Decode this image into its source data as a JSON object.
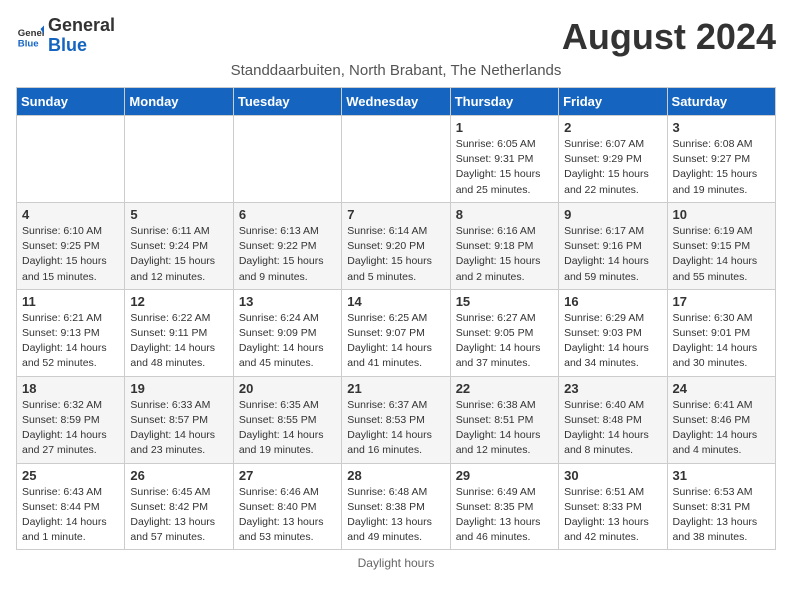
{
  "header": {
    "logo_general": "General",
    "logo_blue": "Blue",
    "month_title": "August 2024",
    "subtitle": "Standdaarbuiten, North Brabant, The Netherlands"
  },
  "days_of_week": [
    "Sunday",
    "Monday",
    "Tuesday",
    "Wednesday",
    "Thursday",
    "Friday",
    "Saturday"
  ],
  "footer": "Daylight hours",
  "weeks": [
    [
      {
        "day": "",
        "info": ""
      },
      {
        "day": "",
        "info": ""
      },
      {
        "day": "",
        "info": ""
      },
      {
        "day": "",
        "info": ""
      },
      {
        "day": "1",
        "info": "Sunrise: 6:05 AM\nSunset: 9:31 PM\nDaylight: 15 hours\nand 25 minutes."
      },
      {
        "day": "2",
        "info": "Sunrise: 6:07 AM\nSunset: 9:29 PM\nDaylight: 15 hours\nand 22 minutes."
      },
      {
        "day": "3",
        "info": "Sunrise: 6:08 AM\nSunset: 9:27 PM\nDaylight: 15 hours\nand 19 minutes."
      }
    ],
    [
      {
        "day": "4",
        "info": "Sunrise: 6:10 AM\nSunset: 9:25 PM\nDaylight: 15 hours\nand 15 minutes."
      },
      {
        "day": "5",
        "info": "Sunrise: 6:11 AM\nSunset: 9:24 PM\nDaylight: 15 hours\nand 12 minutes."
      },
      {
        "day": "6",
        "info": "Sunrise: 6:13 AM\nSunset: 9:22 PM\nDaylight: 15 hours\nand 9 minutes."
      },
      {
        "day": "7",
        "info": "Sunrise: 6:14 AM\nSunset: 9:20 PM\nDaylight: 15 hours\nand 5 minutes."
      },
      {
        "day": "8",
        "info": "Sunrise: 6:16 AM\nSunset: 9:18 PM\nDaylight: 15 hours\nand 2 minutes."
      },
      {
        "day": "9",
        "info": "Sunrise: 6:17 AM\nSunset: 9:16 PM\nDaylight: 14 hours\nand 59 minutes."
      },
      {
        "day": "10",
        "info": "Sunrise: 6:19 AM\nSunset: 9:15 PM\nDaylight: 14 hours\nand 55 minutes."
      }
    ],
    [
      {
        "day": "11",
        "info": "Sunrise: 6:21 AM\nSunset: 9:13 PM\nDaylight: 14 hours\nand 52 minutes."
      },
      {
        "day": "12",
        "info": "Sunrise: 6:22 AM\nSunset: 9:11 PM\nDaylight: 14 hours\nand 48 minutes."
      },
      {
        "day": "13",
        "info": "Sunrise: 6:24 AM\nSunset: 9:09 PM\nDaylight: 14 hours\nand 45 minutes."
      },
      {
        "day": "14",
        "info": "Sunrise: 6:25 AM\nSunset: 9:07 PM\nDaylight: 14 hours\nand 41 minutes."
      },
      {
        "day": "15",
        "info": "Sunrise: 6:27 AM\nSunset: 9:05 PM\nDaylight: 14 hours\nand 37 minutes."
      },
      {
        "day": "16",
        "info": "Sunrise: 6:29 AM\nSunset: 9:03 PM\nDaylight: 14 hours\nand 34 minutes."
      },
      {
        "day": "17",
        "info": "Sunrise: 6:30 AM\nSunset: 9:01 PM\nDaylight: 14 hours\nand 30 minutes."
      }
    ],
    [
      {
        "day": "18",
        "info": "Sunrise: 6:32 AM\nSunset: 8:59 PM\nDaylight: 14 hours\nand 27 minutes."
      },
      {
        "day": "19",
        "info": "Sunrise: 6:33 AM\nSunset: 8:57 PM\nDaylight: 14 hours\nand 23 minutes."
      },
      {
        "day": "20",
        "info": "Sunrise: 6:35 AM\nSunset: 8:55 PM\nDaylight: 14 hours\nand 19 minutes."
      },
      {
        "day": "21",
        "info": "Sunrise: 6:37 AM\nSunset: 8:53 PM\nDaylight: 14 hours\nand 16 minutes."
      },
      {
        "day": "22",
        "info": "Sunrise: 6:38 AM\nSunset: 8:51 PM\nDaylight: 14 hours\nand 12 minutes."
      },
      {
        "day": "23",
        "info": "Sunrise: 6:40 AM\nSunset: 8:48 PM\nDaylight: 14 hours\nand 8 minutes."
      },
      {
        "day": "24",
        "info": "Sunrise: 6:41 AM\nSunset: 8:46 PM\nDaylight: 14 hours\nand 4 minutes."
      }
    ],
    [
      {
        "day": "25",
        "info": "Sunrise: 6:43 AM\nSunset: 8:44 PM\nDaylight: 14 hours\nand 1 minute."
      },
      {
        "day": "26",
        "info": "Sunrise: 6:45 AM\nSunset: 8:42 PM\nDaylight: 13 hours\nand 57 minutes."
      },
      {
        "day": "27",
        "info": "Sunrise: 6:46 AM\nSunset: 8:40 PM\nDaylight: 13 hours\nand 53 minutes."
      },
      {
        "day": "28",
        "info": "Sunrise: 6:48 AM\nSunset: 8:38 PM\nDaylight: 13 hours\nand 49 minutes."
      },
      {
        "day": "29",
        "info": "Sunrise: 6:49 AM\nSunset: 8:35 PM\nDaylight: 13 hours\nand 46 minutes."
      },
      {
        "day": "30",
        "info": "Sunrise: 6:51 AM\nSunset: 8:33 PM\nDaylight: 13 hours\nand 42 minutes."
      },
      {
        "day": "31",
        "info": "Sunrise: 6:53 AM\nSunset: 8:31 PM\nDaylight: 13 hours\nand 38 minutes."
      }
    ]
  ]
}
